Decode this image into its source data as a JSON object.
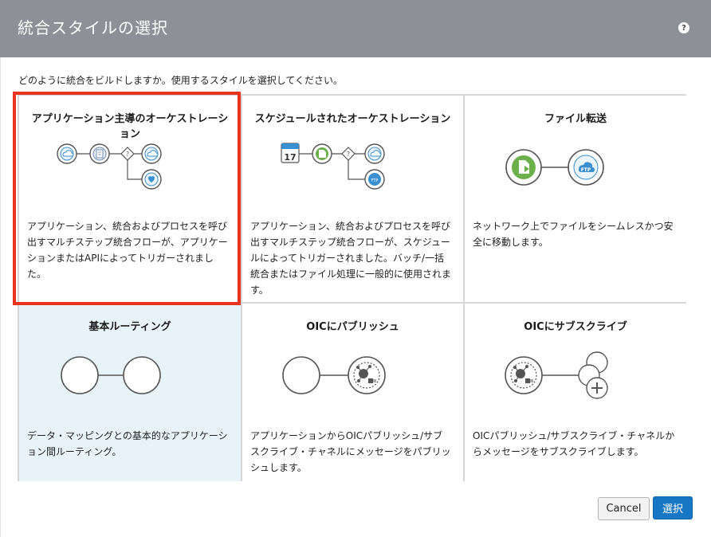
{
  "dialog": {
    "title": "統合スタイルの選択",
    "help_icon": "?",
    "instruction": "どのように統合をビルドしますか。使用するスタイルを選択してください。"
  },
  "cards": [
    {
      "title": "アプリケーション主導のオーケストレーション",
      "description": "アプリケーション、統合およびプロセスを呼び出すマルチステップ統合フローが、アプリケーションまたはAPIによってトリガーされました。",
      "icon": "app-driven-orchestration-diagram",
      "selected": true
    },
    {
      "title": "スケジュールされたオーケストレーション",
      "description": "アプリケーション、統合およびプロセスを呼び出すマルチステップ統合フローが、スケジュールによってトリガーされました。バッチ/一括統合またはファイル処理に一般的に使用されます。",
      "icon": "scheduled-orchestration-diagram",
      "calendar_day": "17",
      "selected": false
    },
    {
      "title": "ファイル転送",
      "description": "ネットワーク上でファイルをシームレスかつ安全に移動します。",
      "icon": "file-transfer-diagram",
      "ftp_label": "FTP",
      "selected": false
    },
    {
      "title": "基本ルーティング",
      "description": "データ・マッピングとの基本的なアプリケーション間ルーティング。",
      "icon": "basic-routing-diagram",
      "selected": false
    },
    {
      "title": "OICにパブリッシュ",
      "description": "アプリケーションからOICパブリッシュ/サブスクライブ・チャネルにメッセージをパブリッシュします。",
      "icon": "publish-to-oic-diagram",
      "selected": false
    },
    {
      "title": "OICにサブスクライブ",
      "description": "OICパブリッシュ/サブスクライブ・チャネルからメッセージをサブスクライブします。",
      "icon": "subscribe-to-oic-diagram",
      "selected": false
    }
  ],
  "footer": {
    "cancel_label": "Cancel",
    "select_label": "選択"
  },
  "colors": {
    "header_bg": "#8e9098",
    "accent_blue": "#1677c4",
    "selection_red": "#e8331f",
    "icon_blue": "#3a8fd0",
    "icon_green": "#6bb04a",
    "routing_bg": "#e8f3f9"
  }
}
